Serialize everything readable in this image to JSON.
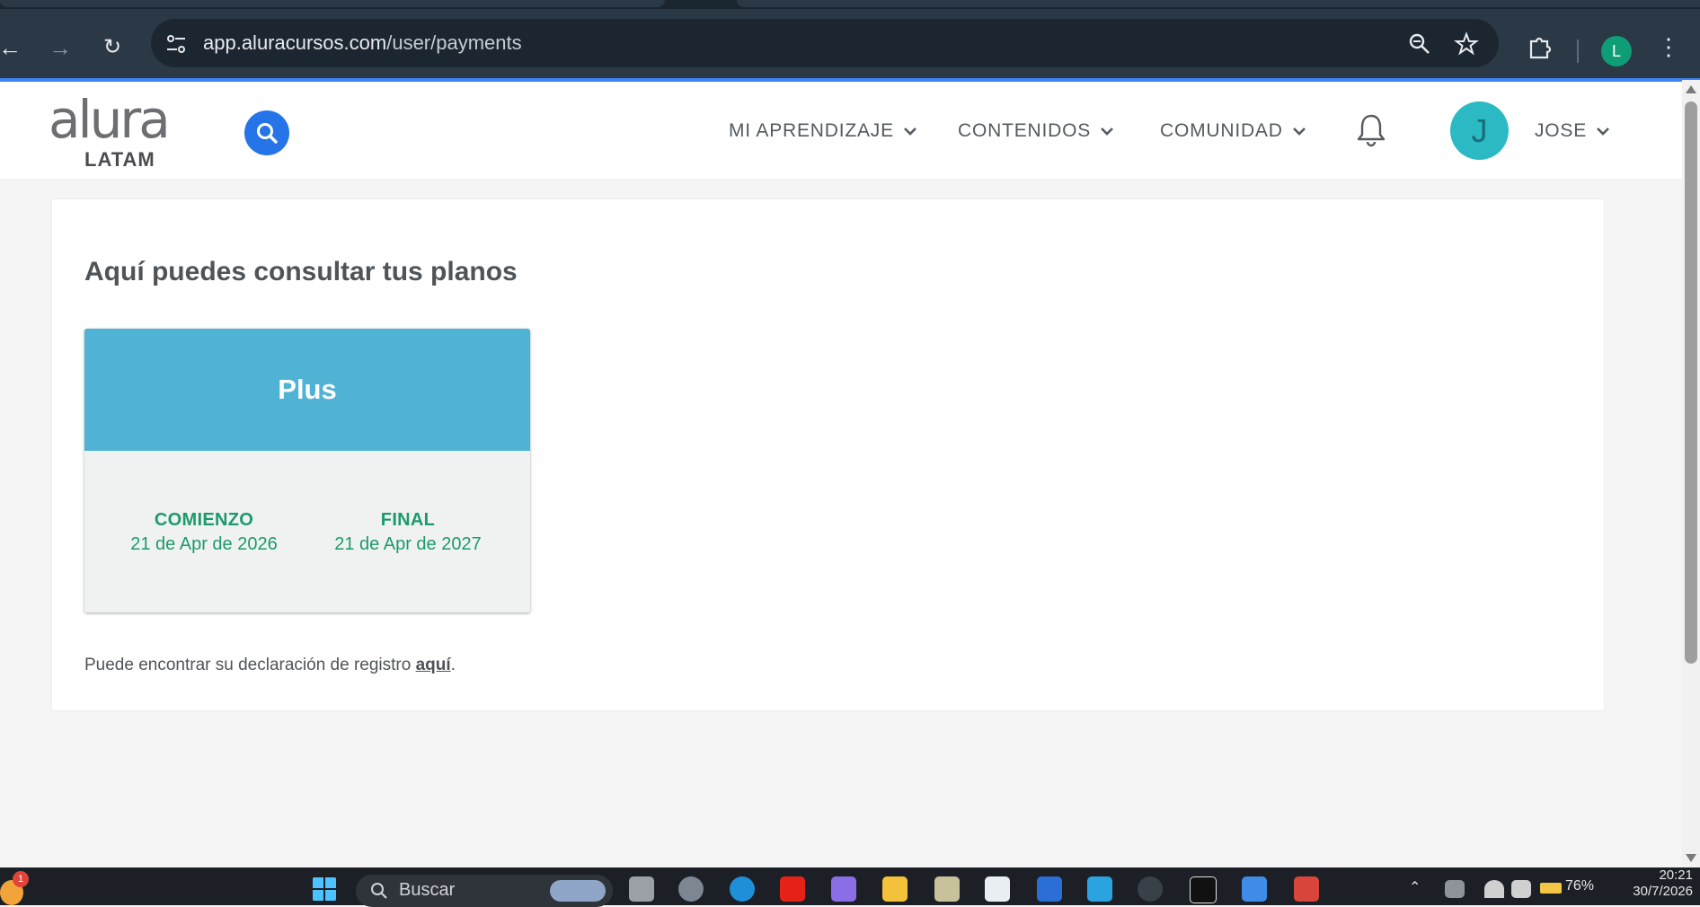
{
  "browser": {
    "url_host": "app.aluracursos.com",
    "url_path": "/user/payments",
    "profile_initial": "L"
  },
  "site": {
    "logo_word": "alura",
    "logo_sub": "LATAM",
    "menu": [
      {
        "label": "MI APRENDIZAJE"
      },
      {
        "label": "CONTENIDOS"
      },
      {
        "label": "COMUNIDAD"
      }
    ],
    "avatar_initial": "J",
    "username": "JOSE"
  },
  "page": {
    "title": "Aquí puedes consultar tus planos",
    "plan": {
      "name": "Plus",
      "start_label": "COMIENZO",
      "start_date": "21 de Apr de 2026",
      "end_label": "FINAL",
      "end_date": "21 de Apr de 2027"
    },
    "footnote_prefix": "Puede encontrar su declaración de registro ",
    "footnote_link": "aquí",
    "footnote_suffix": "."
  },
  "taskbar": {
    "search_placeholder": "Buscar",
    "battery": "76%",
    "time": "20:21",
    "date": "30/7/2026",
    "notification_count": "1"
  },
  "colors": {
    "accent_blue": "#2574e8",
    "plan_header": "#50b2d5",
    "plan_text_green": "#1d9a6c",
    "avatar_teal": "#2bbac4"
  }
}
